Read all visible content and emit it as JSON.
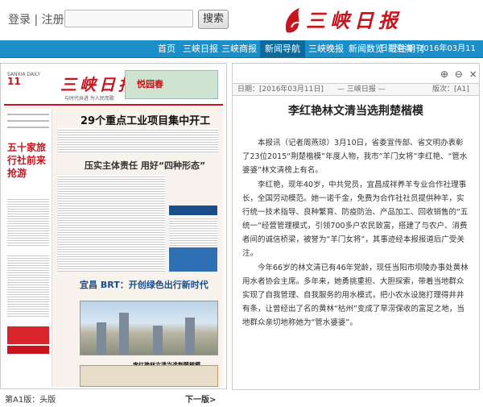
{
  "header": {
    "login_label": "登录",
    "separator": "|",
    "register_label": "注册",
    "search_placeholder": "",
    "search_button": "搜索",
    "brand": "三峡日报"
  },
  "nav": {
    "items": [
      {
        "label": "首页"
      },
      {
        "label": "三峡日报"
      },
      {
        "label": "三峡商报"
      },
      {
        "label": "新闻导航"
      },
      {
        "label": "三峡晚报"
      },
      {
        "label": "新闻数览"
      },
      {
        "label": "过往期刊"
      }
    ],
    "active_index": 3,
    "date_label": "日期查询：",
    "date_value": "2016年03月11日"
  },
  "paper_preview": {
    "masthead": "三峡日报",
    "masthead_sub": "与时代共进  为人民而歌",
    "issue_number": "11",
    "issue_meta": "SANXIA DAILY",
    "ad_text": "悦园春",
    "side_headline": "五十家旅行社前来抢游",
    "headline_main": "29个重点工业项目集中开工",
    "headline_second": "压实主体责任  用好“四种形态”",
    "headline_third": "宜昌 BRT：开创绿色出行新时代",
    "headline_small": "李红艳林文清当选荆楚楷模",
    "page_label": "第A1版：头版",
    "next_page": "下一版>"
  },
  "article": {
    "controls": [
      "⊕",
      "⊖",
      "×"
    ],
    "date": "日期：[2016年03月11日]",
    "paper": "— 三峡日报 —",
    "page": "版次：[A1]",
    "title": "李红艳林文清当选荆楚楷模",
    "paragraphs": [
      "本报讯（记者周燕琼）3月10日，省委宣传部、省文明办表彰了23位2015“荆楚楷模”年度人物，我市“羊门女将”李红艳、“管水婆婆”林文清榜上有名。",
      "李红艳，现年40岁，中共党员，宜昌成祥养羊专业合作社理事长，全国劳动模范。她一诺千金，免费为合作社社员提供种羊，实行统一技术指导、良种繁育、防疫防治、产品加工、回收销售的“五统一”经营管理模式，引领700多户农民致富，搭建了与农户、消费者间的诚信桥梁，被誉为“羊门女将”，其事迹经本报报道后广受关注。",
      "今年66岁的林文清已有46年党龄，现任当阳市坝陵办事处黄林用水者协会主席。多年来，她勇挑重担、大胆探索，带着当地群众实现了自我管理、自我服务的用水模式，把小农水设施打理得井井有条，让曾经出了名的黄林“枯州”变成了旱涝保收的富足之地，当地群众亲切地称她为“管水婆婆”。"
    ]
  }
}
